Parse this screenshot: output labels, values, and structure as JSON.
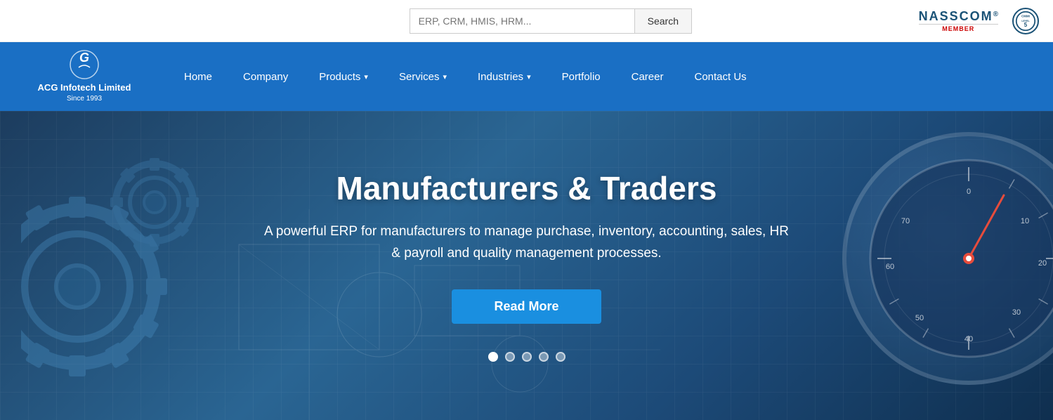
{
  "topbar": {
    "search_placeholder": "ERP, CRM, HMIS, HRM...",
    "search_label": "Search"
  },
  "logo": {
    "company_name": "ACG Infotech Limited",
    "since": "Since 1993",
    "icon_letter": "G"
  },
  "nav": {
    "items": [
      {
        "id": "home",
        "label": "Home",
        "has_dropdown": false
      },
      {
        "id": "company",
        "label": "Company",
        "has_dropdown": false
      },
      {
        "id": "products",
        "label": "Products",
        "has_dropdown": true
      },
      {
        "id": "services",
        "label": "Services",
        "has_dropdown": true
      },
      {
        "id": "industries",
        "label": "Industries",
        "has_dropdown": true
      },
      {
        "id": "portfolio",
        "label": "Portfolio",
        "has_dropdown": false
      },
      {
        "id": "career",
        "label": "Career",
        "has_dropdown": false
      },
      {
        "id": "contact",
        "label": "Contact Us",
        "has_dropdown": false
      }
    ]
  },
  "hero": {
    "title": "Manufacturers & Traders",
    "subtitle": "A powerful ERP for manufacturers to manage purchase, inventory, accounting, sales, HR & payroll and quality management processes.",
    "cta_label": "Read More",
    "dots": [
      {
        "active": true
      },
      {
        "active": false
      },
      {
        "active": false
      },
      {
        "active": false
      },
      {
        "active": false
      }
    ]
  },
  "badges": {
    "nasscom_top": "NASSCOM",
    "nasscom_registered": "®",
    "nasscom_member": "MEMBER",
    "cmmi_label": "CMMI"
  }
}
